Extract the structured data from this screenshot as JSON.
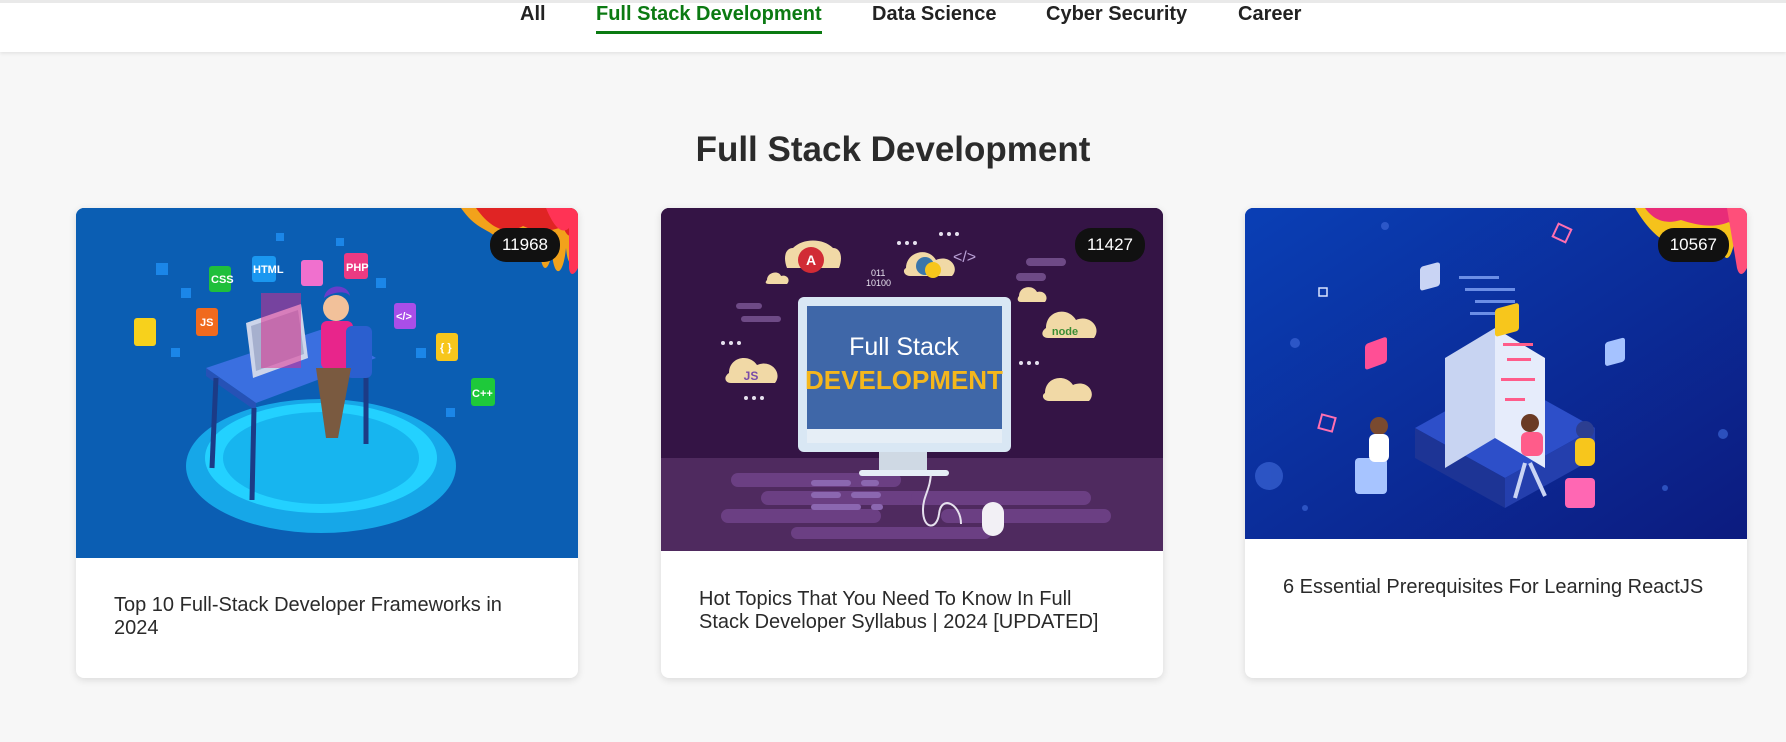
{
  "nav": {
    "tabs": [
      {
        "label": "All"
      },
      {
        "label": "Full Stack Development"
      },
      {
        "label": "Data Science"
      },
      {
        "label": "Cyber Security"
      },
      {
        "label": "Career"
      }
    ],
    "active_index": 1,
    "active_color": "#0b7a12"
  },
  "section": {
    "title": "Full Stack Development"
  },
  "cards": [
    {
      "views": "11968",
      "title": "Top 10 Full-Stack Developer Frameworks in 2024"
    },
    {
      "views": "11427",
      "title": "Hot Topics That You Need To Know In Full Stack Developer Syllabus | 2024 [UPDATED]",
      "image_text": {
        "line1": "Full Stack",
        "line2": "DEVELOPMENT",
        "icons": [
          "A",
          "JS",
          "node",
          "011",
          "10100",
          "</>"
        ]
      }
    },
    {
      "views": "10567",
      "title": "6 Essential Prerequisites For Learning ReactJS"
    }
  ],
  "card1_image_tags": [
    "CSS",
    "HTML",
    "PHP",
    "JS",
    "</>",
    "{ }",
    "C++"
  ]
}
